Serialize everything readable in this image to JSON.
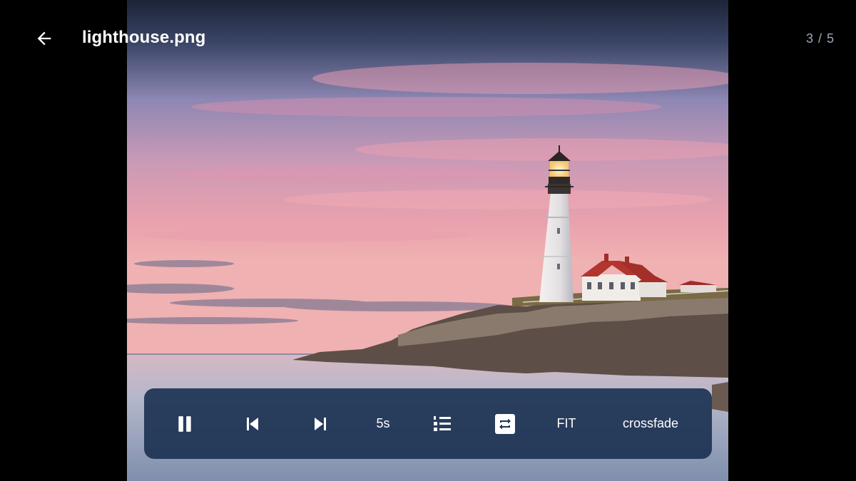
{
  "header": {
    "back_icon": "arrow-left-icon",
    "title": "lighthouse.png",
    "counter": "3 / 5"
  },
  "image": {
    "subject": "lighthouse-photo",
    "colors": {
      "sky_top": "#2b3550",
      "sky_pink": "#e89aa8",
      "water": "#a9b3c6",
      "rocks": "#5b4e46"
    }
  },
  "controls": {
    "pause_icon": "pause-icon",
    "prev_icon": "skip-previous-icon",
    "next_icon": "skip-next-icon",
    "interval_label": "5s",
    "order_icon": "numbered-list-icon",
    "repeat_icon": "repeat-icon",
    "scale_label": "FIT",
    "transition_label": "crossfade"
  }
}
